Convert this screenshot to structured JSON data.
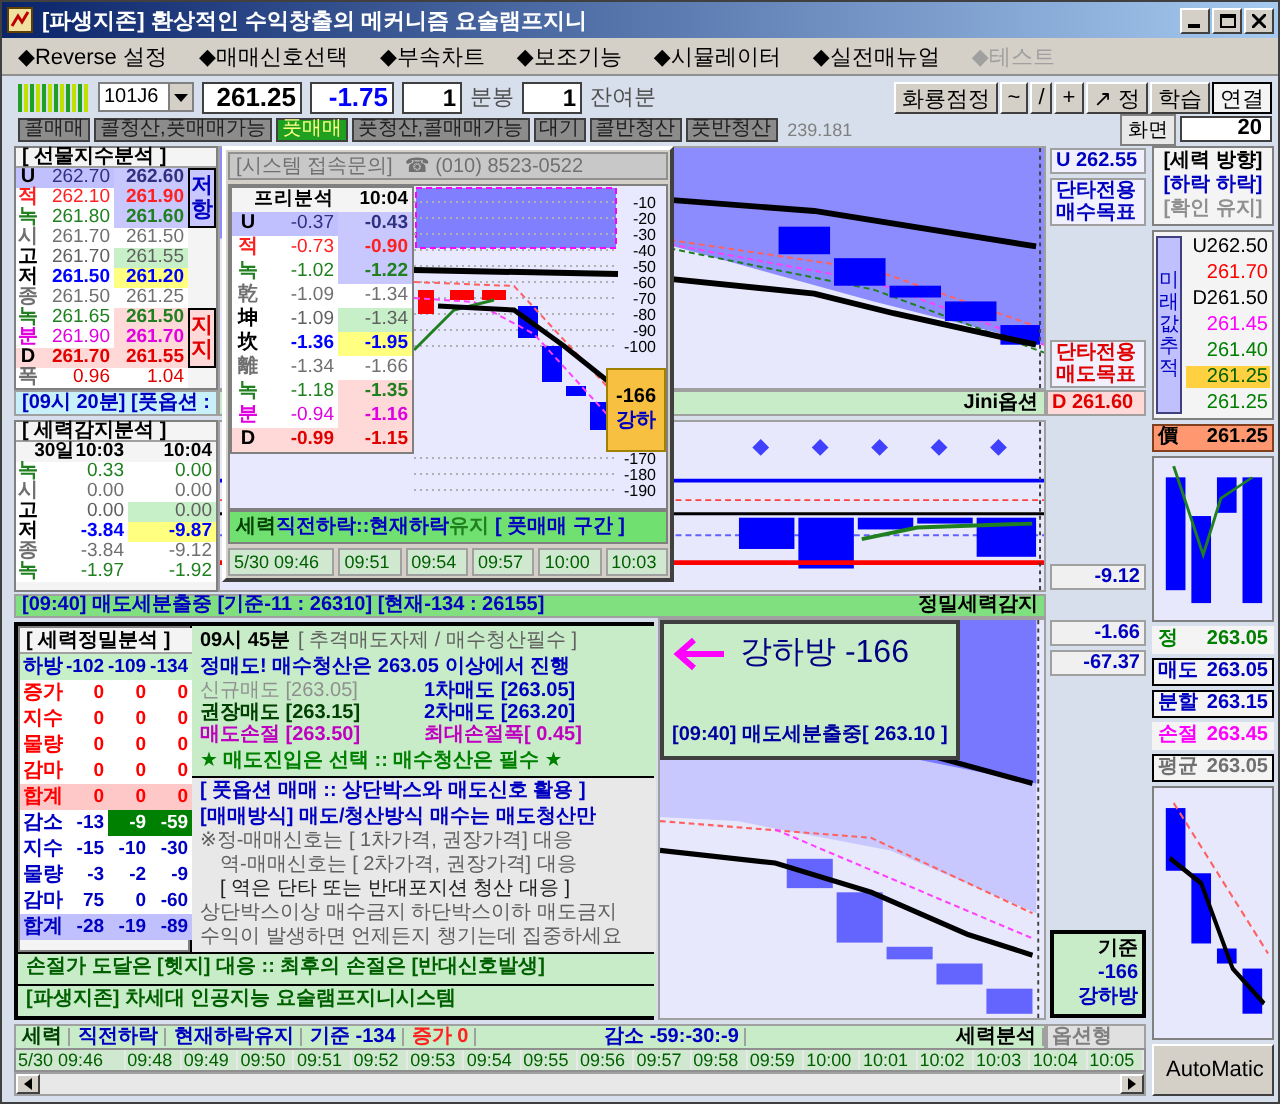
{
  "window": {
    "title": "[파생지존] 환상적인 수익창출의 메커니즘 요술램프지니"
  },
  "menu": [
    {
      "label": "◆Reverse 설정",
      "disabled": false
    },
    {
      "label": "◆매매신호선택",
      "disabled": false
    },
    {
      "label": "◆부속차트",
      "disabled": false
    },
    {
      "label": "◆보조기능",
      "disabled": false
    },
    {
      "label": "◆시뮬레이터",
      "disabled": false
    },
    {
      "label": "◆실전매뉴얼",
      "disabled": false
    },
    {
      "label": "◆테스트",
      "disabled": true
    }
  ],
  "toolbar": {
    "code": "101J6",
    "price": "261.25",
    "change": "-1.75",
    "interval": "1",
    "interval_unit": "분봉",
    "remaining": "1",
    "remaining_unit": "잔여분",
    "buttons": [
      {
        "label": "화룡점정",
        "selected": false
      },
      {
        "label": "~",
        "selected": false
      },
      {
        "label": "/",
        "selected": false
      },
      {
        "label": "+",
        "selected": false
      },
      {
        "label": "↗ 정",
        "selected": false
      },
      {
        "label": "학습",
        "selected": false
      },
      {
        "label": "연결",
        "selected": true
      }
    ]
  },
  "signals": {
    "tags": [
      {
        "label": "콜매매",
        "selected": false
      },
      {
        "label": "콜청산,풋매매가능",
        "selected": false
      },
      {
        "label": "풋매매",
        "selected": true
      },
      {
        "label": "풋청산,콜매매가능",
        "selected": false
      },
      {
        "label": "대기",
        "selected": false
      },
      {
        "label": "콜반청산",
        "selected": false
      },
      {
        "label": "풋반청산",
        "selected": false
      }
    ],
    "reading": "239.181",
    "screen_label": "화면",
    "screen_value": "20"
  },
  "futures_panel": {
    "title": "[ 선물지수분석 ]",
    "rows": [
      {
        "label": "U",
        "values": [
          "262.70",
          "262.60"
        ],
        "kind": "upper"
      },
      {
        "label": "적",
        "values": [
          "262.10",
          "261.90"
        ],
        "kind": "red"
      },
      {
        "label": "녹",
        "values": [
          "261.80",
          "261.60"
        ],
        "kind": "green-resist"
      },
      {
        "label": "시",
        "values": [
          "261.70",
          "261.50"
        ],
        "kind": "plain"
      },
      {
        "label": "고",
        "values": [
          "261.70",
          "261.55"
        ],
        "kind": "high"
      },
      {
        "label": "저",
        "values": [
          "261.50",
          "261.20"
        ],
        "kind": "low"
      },
      {
        "label": "종",
        "values": [
          "261.50",
          "261.25"
        ],
        "kind": "plain"
      },
      {
        "label": "녹",
        "values": [
          "261.65",
          "261.50"
        ],
        "kind": "green-support"
      },
      {
        "label": "분",
        "values": [
          "261.90",
          "261.70"
        ],
        "kind": "magenta"
      },
      {
        "label": "D",
        "values": [
          "261.70",
          "261.55"
        ],
        "kind": "lower"
      },
      {
        "label": "폭",
        "values": [
          "0.96",
          "1.04"
        ],
        "kind": "width"
      }
    ],
    "side_labels": [
      {
        "text": "저항",
        "kind": "resistance"
      },
      {
        "text": "지지",
        "kind": "support"
      }
    ]
  },
  "banner_top": "[09시 20분] [풋옵션 :",
  "power_panel": {
    "title": "[ 세력감지분석 ]",
    "header": [
      "30일10:03",
      "10:04"
    ],
    "rows": [
      {
        "label": "녹",
        "values": [
          "0.33",
          "0.00"
        ],
        "kind": "green"
      },
      {
        "label": "시",
        "values": [
          "0.00",
          "0.00"
        ],
        "kind": "plain"
      },
      {
        "label": "고",
        "values": [
          "0.00",
          "0.00"
        ],
        "kind": "high"
      },
      {
        "label": "저",
        "values": [
          "-3.84",
          "-9.87"
        ],
        "kind": "low"
      },
      {
        "label": "종",
        "values": [
          "-3.84",
          "-9.12"
        ],
        "kind": "plain"
      },
      {
        "label": "녹",
        "values": [
          "-1.97",
          "-1.92"
        ],
        "kind": "green"
      }
    ]
  },
  "main_chart": {
    "upper": "U 262.55",
    "buy_target": "단타전용 매수목표",
    "sell_target": "단타전용 매도목표",
    "caption": "Jini옵션",
    "lower": "D 261.60"
  },
  "power_chart": {
    "reading": "-9.12"
  },
  "alert_banner": {
    "text": "[09:40] 매도세분출중 [기준-11 : 26310] [현재-134 : 26155]",
    "caption": "정밀세력감지"
  },
  "precision_panel": {
    "title": "[ 세력정밀분석 ]",
    "header": {
      "label": "하방",
      "values": [
        "-102",
        "-109",
        "-134"
      ]
    },
    "rows": [
      {
        "label": "증가",
        "values": [
          "0",
          "0",
          "0"
        ],
        "kind": "increase"
      },
      {
        "label": "지수",
        "values": [
          "0",
          "0",
          "0"
        ],
        "kind": "increase"
      },
      {
        "label": "물량",
        "values": [
          "0",
          "0",
          "0"
        ],
        "kind": "increase"
      },
      {
        "label": "감마",
        "values": [
          "0",
          "0",
          "0"
        ],
        "kind": "increase"
      },
      {
        "label": "합계",
        "values": [
          "0",
          "0",
          "0"
        ],
        "kind": "increase-total"
      },
      {
        "label": "감소",
        "values": [
          "-13",
          "-9",
          "-59"
        ],
        "kind": "decrease-lead"
      },
      {
        "label": "지수",
        "values": [
          "-15",
          "-10",
          "-30"
        ],
        "kind": "decrease"
      },
      {
        "label": "물량",
        "values": [
          "-3",
          "-2",
          "-9"
        ],
        "kind": "decrease"
      },
      {
        "label": "감마",
        "values": [
          "75",
          "0",
          "-60"
        ],
        "kind": "decrease"
      },
      {
        "label": "합계",
        "values": [
          "-28",
          "-19",
          "-89"
        ],
        "kind": "decrease-total"
      }
    ]
  },
  "notice": {
    "time": "09시 45분",
    "heading": "[ 추격매도자제 / 매수청산필수 ]",
    "headline": "정매도! 매수청산은 263.05 이상에서 진행",
    "orders": [
      {
        "text": "신규매도 [263.05]",
        "kind": "muted"
      },
      {
        "text": "1차매도 [263.05]",
        "kind": "blue"
      },
      {
        "text": "권장매도 [263.15]",
        "kind": "dark"
      },
      {
        "text": "2차매도 [263.20]",
        "kind": "blue"
      },
      {
        "text": "매도손절 [263.50]",
        "kind": "magenta"
      },
      {
        "text": "최대손절폭[ 0.45]",
        "kind": "magenta"
      }
    ],
    "motto": "★ 매도진입은 선택 :: 매수청산은 필수 ★",
    "guide": [
      {
        "text": "[ 풋옵션 매매 :: 상단박스와 매도신호 활용 ]",
        "kind": "blue"
      },
      {
        "text": "[매매방식] 매도/청산방식 매수는 매도청산만",
        "kind": "strong"
      },
      {
        "text": "※정-매매신호는 [ 1차가격, 권장가격] 대응",
        "kind": "gray"
      },
      {
        "text": "역-매매신호는 [ 2차가격, 권장가격] 대응",
        "kind": "gray-indent"
      },
      {
        "text": "[ 역은 단타 또는 반대포지션 청산 대응 ]",
        "kind": "dark-indent"
      },
      {
        "text": "상단박스이상 매수금지 하단박스이하 매도금지",
        "kind": "gray"
      },
      {
        "text": "수익이 발생하면 언제든지 챙기는데 집중하세요",
        "kind": "gray"
      }
    ],
    "bars": [
      "손절가 도달은 [헷지] 대응 :: 최후의 손절은 [반대신호발생]",
      "[파생지존] 차세대 인공지능 요술램프지니시스템"
    ]
  },
  "alert_box": {
    "title": "강하방 -166",
    "detail": "[09:40] 매도세분출중[ 263.10 ]"
  },
  "signal_chart": {
    "readings": [
      "-1.66",
      "-67.37"
    ],
    "reference": {
      "label": "기준",
      "value": "-166",
      "state": "강하방"
    }
  },
  "status_bar": {
    "segments": [
      {
        "text": "세력",
        "kind": "dark"
      },
      {
        "text": "직전하락",
        "kind": "blue"
      },
      {
        "text": "현재하락유지",
        "kind": "blue"
      },
      {
        "text": "기준 -134",
        "kind": "blue"
      },
      {
        "text": "증가 0",
        "kind": "red"
      }
    ],
    "decrease": "감소 -59:-30:-9",
    "right": "세력분석",
    "mode": "옵션형"
  },
  "time_axis": [
    "5/30 09:46",
    "09:48",
    "09:49",
    "09:50",
    "09:51",
    "09:52",
    "09:53",
    "09:54",
    "09:55",
    "09:56",
    "09:57",
    "09:58",
    "09:59",
    "10:00",
    "10:01",
    "10:02",
    "10:03",
    "10:04",
    "10:05"
  ],
  "direction": {
    "title": "[세력 방향]",
    "status": "[하락 하락]",
    "confirm": "[확인 유지]"
  },
  "future_tracking": {
    "label": "미래값추적",
    "values": [
      {
        "text": "U262.50",
        "kind": "upper"
      },
      {
        "text": "261.70",
        "kind": "red"
      },
      {
        "text": "D261.50",
        "kind": "lower"
      },
      {
        "text": "261.45",
        "kind": "magenta"
      },
      {
        "text": "261.40",
        "kind": "green"
      },
      {
        "text": "261.25",
        "kind": "current"
      },
      {
        "text": "261.25",
        "kind": "green"
      }
    ]
  },
  "current_price": {
    "label": "價",
    "value": "261.25"
  },
  "targets": [
    {
      "label": "정",
      "value": "263.05",
      "kind": "green"
    },
    {
      "label": "매도",
      "value": "263.05",
      "kind": "boxed"
    },
    {
      "label": "분할",
      "value": "263.15",
      "kind": "boxed"
    },
    {
      "label": "손절",
      "value": "263.45",
      "kind": "magenta"
    },
    {
      "label": "평균",
      "value": "263.05",
      "kind": "muted"
    }
  ],
  "automatic_button": "AutoMatic",
  "popup": {
    "title": "[시스템 접속문의]",
    "phone": "☎ (010) 8523-0522",
    "header": [
      "프리분석",
      "10:04"
    ],
    "rows": [
      {
        "label": "U",
        "values": [
          "-0.37",
          "-0.43"
        ],
        "kind": "upper"
      },
      {
        "label": "적",
        "values": [
          "-0.73",
          "-0.90"
        ],
        "kind": "red"
      },
      {
        "label": "녹",
        "values": [
          "-1.02",
          "-1.22"
        ],
        "kind": "green-resist"
      },
      {
        "label": "乾",
        "values": [
          "-1.09",
          "-1.34"
        ],
        "kind": "plain"
      },
      {
        "label": "坤",
        "values": [
          "-1.09",
          "-1.34"
        ],
        "kind": "high"
      },
      {
        "label": "坎",
        "values": [
          "-1.36",
          "-1.95"
        ],
        "kind": "low"
      },
      {
        "label": "離",
        "values": [
          "-1.34",
          "-1.66"
        ],
        "kind": "plain"
      },
      {
        "label": "녹",
        "values": [
          "-1.18",
          "-1.35"
        ],
        "kind": "green-support"
      },
      {
        "label": "분",
        "values": [
          "-0.94",
          "-1.16"
        ],
        "kind": "magenta"
      },
      {
        "label": "D",
        "values": [
          "-0.99",
          "-1.15"
        ],
        "kind": "lower"
      }
    ],
    "ticks": [
      "-10",
      "-20",
      "-30",
      "-40",
      "-50",
      "-60",
      "-70",
      "-80",
      "-90",
      "-100",
      "-170",
      "-180",
      "-190"
    ],
    "marker": {
      "value": "-166",
      "label": "강하"
    },
    "banner": [
      {
        "text": "세력",
        "kind": "dark"
      },
      {
        "text": "직전하락::",
        "kind": "blue"
      },
      {
        "text": "현재하락",
        "kind": "blue"
      },
      {
        "text": "유지 ",
        "kind": "green"
      },
      {
        "text": "[ 풋매매 구간 ]",
        "kind": "blue"
      }
    ],
    "times": [
      "5/30 09:46",
      "09:51",
      "09:54",
      "09:57",
      "10:00",
      "10:03"
    ]
  }
}
